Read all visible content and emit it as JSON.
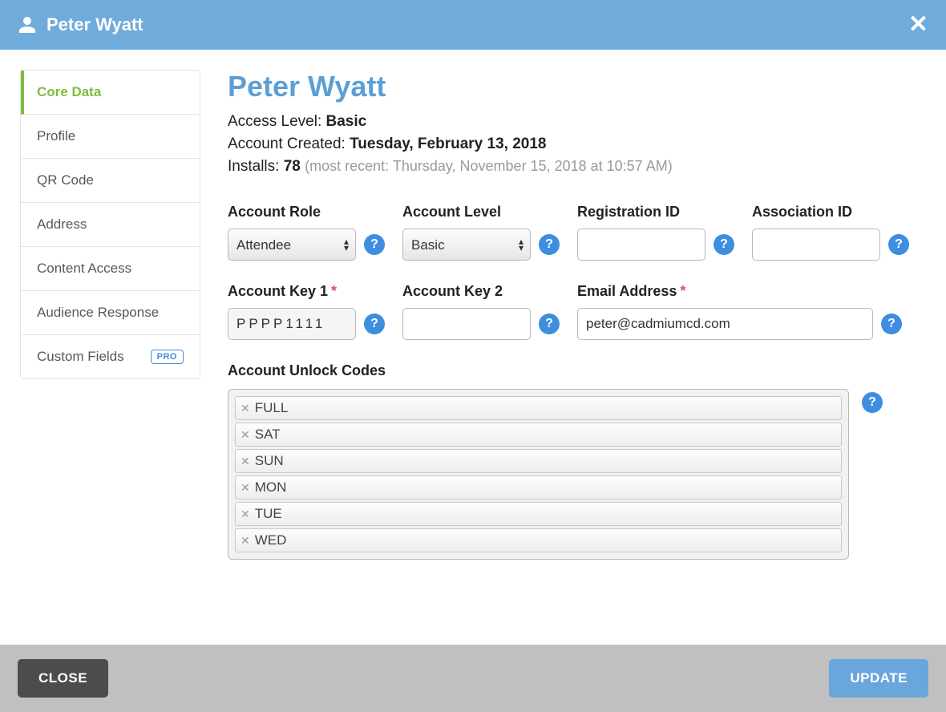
{
  "header": {
    "title": "Peter Wyatt"
  },
  "sidebar": {
    "items": [
      {
        "label": "Core Data",
        "active": true
      },
      {
        "label": "Profile"
      },
      {
        "label": "QR Code"
      },
      {
        "label": "Address"
      },
      {
        "label": "Content Access"
      },
      {
        "label": "Audience Response"
      },
      {
        "label": "Custom Fields",
        "badge": "PRO"
      }
    ]
  },
  "page": {
    "title": "Peter Wyatt",
    "access_level_label": "Access Level:",
    "access_level_value": "Basic",
    "created_label": "Account Created:",
    "created_value": "Tuesday, February 13, 2018",
    "installs_label": "Installs:",
    "installs_value": "78",
    "installs_hint": "(most recent: Thursday, November 15, 2018 at 10:57 AM)"
  },
  "fields": {
    "account_role": {
      "label": "Account Role",
      "value": "Attendee"
    },
    "account_level": {
      "label": "Account Level",
      "value": "Basic"
    },
    "registration_id": {
      "label": "Registration ID",
      "value": ""
    },
    "association_id": {
      "label": "Association ID",
      "value": ""
    },
    "account_key_1": {
      "label": "Account Key 1",
      "required": true,
      "value": "PPPP1111"
    },
    "account_key_2": {
      "label": "Account Key 2",
      "value": ""
    },
    "email": {
      "label": "Email Address",
      "required": true,
      "value": "peter@cadmiumcd.com"
    },
    "unlock_codes": {
      "label": "Account Unlock Codes",
      "codes": [
        "FULL",
        "SAT",
        "SUN",
        "MON",
        "TUE",
        "WED"
      ]
    }
  },
  "footer": {
    "close": "CLOSE",
    "update": "UPDATE"
  }
}
